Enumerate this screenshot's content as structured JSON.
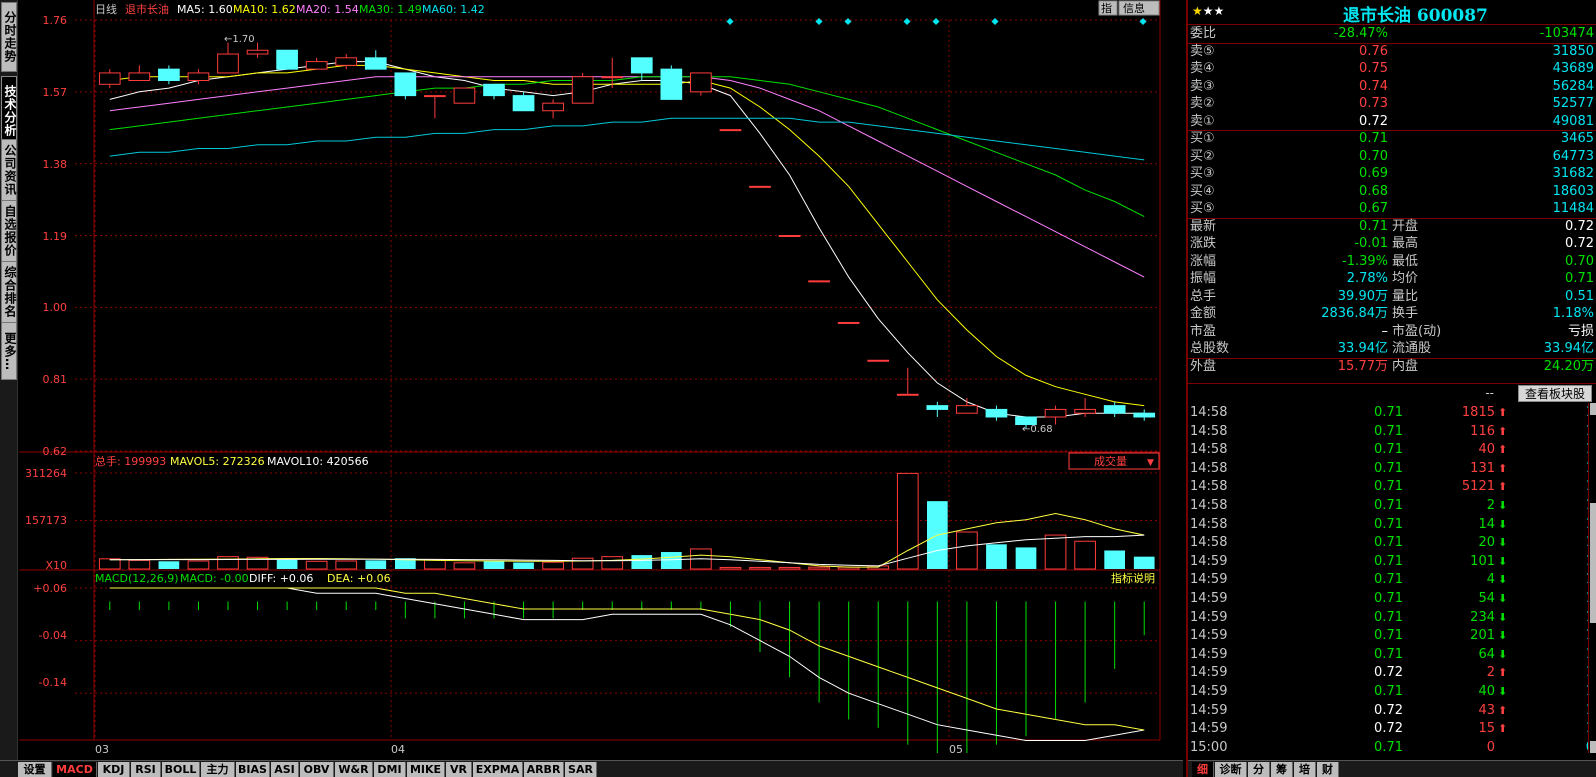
{
  "left_tabs": [
    {
      "label": "分时走势",
      "active": false
    },
    {
      "label": "技术分析",
      "active": true
    },
    {
      "label": "公司资讯",
      "active": false
    },
    {
      "label": "自选报价",
      "active": false
    },
    {
      "label": "综合排名",
      "active": false
    },
    {
      "label": "更多…",
      "active": false
    }
  ],
  "header": {
    "period": "日线",
    "stock_name": "退市长油",
    "ma5": "MA5: 1.60",
    "ma10": "MA10: 1.62",
    "ma20": "MA20: 1.54",
    "ma30": "MA30: 1.49",
    "ma60": "MA60: 1.42",
    "btn_zhi": "指",
    "btn_info": "信息"
  },
  "price_axis_labels": [
    "1.76",
    "1.57",
    "1.38",
    "1.19",
    "1.00",
    "0.81",
    "0.62"
  ],
  "price_annotations": {
    "high": "1.70",
    "low": "0.68"
  },
  "volume_header": {
    "total": "总手: 199993",
    "mavol5": "MAVOL5: 272326",
    "mavol10": "MAVOL10: 420566",
    "dropdown": "成交量"
  },
  "volume_axis_labels": [
    "311264",
    "157173",
    "X10"
  ],
  "macd_header": {
    "name": "MACD(12,26,9)",
    "macd": "MACD: -0.00",
    "diff": "DIFF: +0.06",
    "dea": "DEA: +0.06",
    "help": "指标说明"
  },
  "macd_axis_labels": [
    "+0.06",
    "-0.04",
    "-0.14"
  ],
  "date_labels": [
    "03",
    "04",
    "05"
  ],
  "bottom_tabs": [
    {
      "label": "设置",
      "active": false
    },
    {
      "label": "MACD",
      "active": true
    },
    {
      "label": "KDJ",
      "active": false
    },
    {
      "label": "RSI",
      "active": false
    },
    {
      "label": "BOLL",
      "active": false
    },
    {
      "label": "主力",
      "active": false
    },
    {
      "label": "BIAS",
      "active": false
    },
    {
      "label": "ASI",
      "active": false
    },
    {
      "label": "OBV",
      "active": false
    },
    {
      "label": "W&R",
      "active": false
    },
    {
      "label": "DMI",
      "active": false
    },
    {
      "label": "MIKE",
      "active": false
    },
    {
      "label": "VR",
      "active": false
    },
    {
      "label": "EXPMA",
      "active": false
    },
    {
      "label": "ARBR",
      "active": false
    },
    {
      "label": "SAR",
      "active": false
    }
  ],
  "colors": {
    "up": "#ff3c3c",
    "down": "#54ffff",
    "ma5": "#ffffff",
    "ma10": "#ffff00",
    "ma20": "#ff80ff",
    "ma30": "#00e000",
    "ma60": "#00c8d8",
    "grid": "#8c0000"
  },
  "chart_data": [
    {
      "type": "candlestick",
      "title": "日线",
      "x": [
        "03",
        "04",
        "05"
      ],
      "ylim": [
        0.62,
        1.76
      ],
      "candles": [
        {
          "o": 1.59,
          "c": 1.62,
          "h": 1.63,
          "l": 1.58
        },
        {
          "o": 1.6,
          "c": 1.62,
          "h": 1.64,
          "l": 1.6
        },
        {
          "o": 1.63,
          "c": 1.6,
          "h": 1.64,
          "l": 1.59
        },
        {
          "o": 1.6,
          "c": 1.62,
          "h": 1.63,
          "l": 1.59
        },
        {
          "o": 1.62,
          "c": 1.67,
          "h": 1.7,
          "l": 1.62
        },
        {
          "o": 1.67,
          "c": 1.68,
          "h": 1.7,
          "l": 1.66
        },
        {
          "o": 1.68,
          "c": 1.63,
          "h": 1.68,
          "l": 1.63
        },
        {
          "o": 1.63,
          "c": 1.65,
          "h": 1.66,
          "l": 1.63
        },
        {
          "o": 1.64,
          "c": 1.66,
          "h": 1.67,
          "l": 1.63
        },
        {
          "o": 1.66,
          "c": 1.63,
          "h": 1.68,
          "l": 1.63
        },
        {
          "o": 1.62,
          "c": 1.56,
          "h": 1.62,
          "l": 1.55
        },
        {
          "o": 1.56,
          "c": 1.56,
          "h": 1.56,
          "l": 1.5
        },
        {
          "o": 1.54,
          "c": 1.58,
          "h": 1.58,
          "l": 1.54
        },
        {
          "o": 1.59,
          "c": 1.56,
          "h": 1.59,
          "l": 1.55
        },
        {
          "o": 1.56,
          "c": 1.52,
          "h": 1.57,
          "l": 1.52
        },
        {
          "o": 1.52,
          "c": 1.54,
          "h": 1.55,
          "l": 1.5
        },
        {
          "o": 1.54,
          "c": 1.61,
          "h": 1.62,
          "l": 1.54
        },
        {
          "o": 1.61,
          "c": 1.61,
          "h": 1.66,
          "l": 1.58
        },
        {
          "o": 1.66,
          "c": 1.62,
          "h": 1.66,
          "l": 1.6
        },
        {
          "o": 1.63,
          "c": 1.55,
          "h": 1.64,
          "l": 1.55
        },
        {
          "o": 1.57,
          "c": 1.62,
          "h": 1.62,
          "l": 1.56
        },
        {
          "o": 1.47,
          "c": 1.47,
          "h": 1.47,
          "l": 1.47
        },
        {
          "o": 1.32,
          "c": 1.32,
          "h": 1.32,
          "l": 1.32
        },
        {
          "o": 1.19,
          "c": 1.19,
          "h": 1.19,
          "l": 1.19
        },
        {
          "o": 1.07,
          "c": 1.07,
          "h": 1.07,
          "l": 1.07
        },
        {
          "o": 0.96,
          "c": 0.96,
          "h": 0.96,
          "l": 0.96
        },
        {
          "o": 0.86,
          "c": 0.86,
          "h": 0.86,
          "l": 0.86
        },
        {
          "o": 0.77,
          "c": 0.77,
          "h": 0.84,
          "l": 0.77
        },
        {
          "o": 0.74,
          "c": 0.73,
          "h": 0.75,
          "l": 0.71
        },
        {
          "o": 0.72,
          "c": 0.74,
          "h": 0.76,
          "l": 0.72
        },
        {
          "o": 0.73,
          "c": 0.71,
          "h": 0.74,
          "l": 0.7
        },
        {
          "o": 0.71,
          "c": 0.69,
          "h": 0.71,
          "l": 0.68
        },
        {
          "o": 0.71,
          "c": 0.73,
          "h": 0.74,
          "l": 0.69
        },
        {
          "o": 0.72,
          "c": 0.73,
          "h": 0.76,
          "l": 0.71
        },
        {
          "o": 0.74,
          "c": 0.72,
          "h": 0.75,
          "l": 0.71
        },
        {
          "o": 0.72,
          "c": 0.71,
          "h": 0.73,
          "l": 0.7
        }
      ],
      "ma_series": [
        {
          "name": "MA5",
          "values": [
            1.55,
            1.57,
            1.58,
            1.6,
            1.61,
            1.62,
            1.63,
            1.64,
            1.65,
            1.65,
            1.63,
            1.61,
            1.6,
            1.58,
            1.57,
            1.56,
            1.57,
            1.59,
            1.6,
            1.6,
            1.59,
            1.56,
            1.46,
            1.35,
            1.21,
            1.08,
            0.97,
            0.88,
            0.8,
            0.75,
            0.72,
            0.71,
            0.71,
            0.72,
            0.72,
            0.72
          ]
        },
        {
          "name": "MA10",
          "values": [
            1.6,
            1.61,
            1.61,
            1.61,
            1.61,
            1.62,
            1.62,
            1.63,
            1.64,
            1.64,
            1.63,
            1.62,
            1.61,
            1.6,
            1.6,
            1.59,
            1.59,
            1.59,
            1.59,
            1.59,
            1.6,
            1.58,
            1.53,
            1.47,
            1.4,
            1.32,
            1.22,
            1.12,
            1.02,
            0.94,
            0.87,
            0.82,
            0.79,
            0.77,
            0.75,
            0.74
          ]
        },
        {
          "name": "MA20",
          "values": [
            1.52,
            1.53,
            1.54,
            1.55,
            1.56,
            1.57,
            1.58,
            1.59,
            1.6,
            1.61,
            1.61,
            1.61,
            1.61,
            1.61,
            1.61,
            1.61,
            1.61,
            1.61,
            1.61,
            1.61,
            1.61,
            1.6,
            1.58,
            1.55,
            1.52,
            1.48,
            1.44,
            1.4,
            1.36,
            1.32,
            1.28,
            1.24,
            1.2,
            1.16,
            1.12,
            1.08
          ]
        },
        {
          "name": "MA30",
          "values": [
            1.47,
            1.48,
            1.49,
            1.5,
            1.51,
            1.52,
            1.53,
            1.54,
            1.55,
            1.56,
            1.57,
            1.58,
            1.58,
            1.59,
            1.59,
            1.6,
            1.6,
            1.6,
            1.61,
            1.61,
            1.61,
            1.61,
            1.6,
            1.59,
            1.57,
            1.55,
            1.53,
            1.5,
            1.47,
            1.44,
            1.41,
            1.38,
            1.35,
            1.31,
            1.28,
            1.24
          ]
        },
        {
          "name": "MA60",
          "values": [
            1.4,
            1.41,
            1.41,
            1.42,
            1.42,
            1.43,
            1.43,
            1.44,
            1.44,
            1.45,
            1.45,
            1.46,
            1.46,
            1.47,
            1.47,
            1.48,
            1.48,
            1.49,
            1.49,
            1.5,
            1.5,
            1.5,
            1.5,
            1.5,
            1.49,
            1.49,
            1.48,
            1.47,
            1.46,
            1.45,
            1.44,
            1.43,
            1.42,
            1.41,
            1.4,
            1.39
          ]
        }
      ]
    },
    {
      "type": "bar",
      "title": "成交量",
      "ylim": [
        0,
        311264
      ],
      "values": [
        33000,
        28000,
        25000,
        26000,
        40000,
        38000,
        30000,
        25000,
        26000,
        28000,
        35000,
        30000,
        20000,
        25000,
        21000,
        22000,
        35000,
        40000,
        45000,
        55000,
        65000,
        5000,
        5000,
        5000,
        6000,
        6000,
        10000,
        310000,
        220000,
        120000,
        80000,
        70000,
        110000,
        90000,
        60000,
        40000
      ],
      "mavol5": [
        30000,
        30500,
        31000,
        31500,
        32000,
        33000,
        34000,
        34000,
        33000,
        32000,
        30000,
        28000,
        27000,
        26000,
        25000,
        25000,
        26000,
        28000,
        32000,
        38000,
        45000,
        40000,
        30000,
        20000,
        10000,
        6000,
        6000,
        60000,
        110000,
        130000,
        150000,
        160000,
        180000,
        160000,
        130000,
        110000
      ],
      "mavol10": [
        30000,
        30200,
        30400,
        30600,
        30800,
        31000,
        31200,
        31400,
        31600,
        31800,
        31500,
        31000,
        30500,
        30000,
        29000,
        28000,
        27000,
        27000,
        28000,
        30000,
        33000,
        30000,
        25000,
        20000,
        15000,
        12000,
        10000,
        35000,
        60000,
        75000,
        85000,
        95000,
        100000,
        105000,
        105000,
        110000
      ]
    },
    {
      "type": "bar",
      "title": "MACD(12,26,9)",
      "ylim": [
        -0.21,
        0.06
      ],
      "macd": [
        -0.01,
        -0.01,
        -0.01,
        -0.01,
        -0.01,
        -0.01,
        -0.01,
        -0.01,
        -0.01,
        -0.01,
        -0.02,
        -0.02,
        -0.02,
        -0.02,
        -0.02,
        -0.02,
        -0.01,
        -0.01,
        -0.01,
        -0.01,
        -0.01,
        -0.03,
        -0.06,
        -0.09,
        -0.12,
        -0.14,
        -0.15,
        -0.17,
        -0.18,
        -0.18,
        -0.17,
        -0.16,
        -0.14,
        -0.12,
        -0.08,
        -0.04
      ],
      "diff": [
        0.06,
        0.06,
        0.06,
        0.06,
        0.06,
        0.06,
        0.06,
        0.05,
        0.05,
        0.05,
        0.04,
        0.03,
        0.02,
        0.01,
        0.0,
        0.0,
        0.0,
        0.01,
        0.01,
        0.01,
        0.01,
        -0.01,
        -0.04,
        -0.07,
        -0.11,
        -0.14,
        -0.16,
        -0.18,
        -0.2,
        -0.21,
        -0.22,
        -0.23,
        -0.23,
        -0.23,
        -0.22,
        -0.21
      ],
      "dea": [
        0.06,
        0.06,
        0.06,
        0.06,
        0.06,
        0.06,
        0.06,
        0.06,
        0.06,
        0.06,
        0.05,
        0.05,
        0.04,
        0.03,
        0.02,
        0.02,
        0.02,
        0.02,
        0.02,
        0.02,
        0.02,
        0.01,
        0.0,
        -0.02,
        -0.05,
        -0.07,
        -0.09,
        -0.11,
        -0.13,
        -0.15,
        -0.17,
        -0.18,
        -0.19,
        -0.2,
        -0.2,
        -0.21
      ]
    }
  ],
  "right_panel": {
    "stars_on": "★",
    "stars_off": "★★",
    "title": "退市长油 600087",
    "weibi": {
      "label": "委比",
      "pct": "-28.47%",
      "val": "-103474"
    },
    "asks": [
      {
        "label": "卖⑤",
        "price": "0.76",
        "vol": "31850"
      },
      {
        "label": "卖④",
        "price": "0.75",
        "vol": "43689"
      },
      {
        "label": "卖③",
        "price": "0.74",
        "vol": "56284"
      },
      {
        "label": "卖②",
        "price": "0.73",
        "vol": "52577"
      },
      {
        "label": "卖①",
        "price": "0.72",
        "vol": "49081"
      }
    ],
    "bids": [
      {
        "label": "买①",
        "price": "0.71",
        "vol": "3465"
      },
      {
        "label": "买②",
        "price": "0.70",
        "vol": "64773"
      },
      {
        "label": "买③",
        "price": "0.69",
        "vol": "31682"
      },
      {
        "label": "买④",
        "price": "0.68",
        "vol": "18603"
      },
      {
        "label": "买⑤",
        "price": "0.67",
        "vol": "11484"
      }
    ],
    "stats": [
      {
        "l1": "最新",
        "v1": "0.71",
        "l2": "开盘",
        "v2": "0.72"
      },
      {
        "l1": "涨跌",
        "v1": "-0.01",
        "l2": "最高",
        "v2": "0.72"
      },
      {
        "l1": "涨幅",
        "v1": "-1.39%",
        "l2": "最低",
        "v2": "0.70"
      },
      {
        "l1": "振幅",
        "v1": "2.78%",
        "l2": "均价",
        "v2": "0.71"
      },
      {
        "l1": "总手",
        "v1": "39.90万",
        "l2": "量比",
        "v2": "0.51"
      },
      {
        "l1": "金额",
        "v1": "2836.84万",
        "l2": "换手",
        "v2": "1.18%"
      },
      {
        "l1": "市盈",
        "v1": "–",
        "l2": "市盈(动)",
        "v2": "亏损"
      },
      {
        "l1": "总股数",
        "v1": "33.94亿",
        "l2": "流通股",
        "v2": "33.94亿"
      }
    ],
    "outer": {
      "l1": "外盘",
      "v1": "15.77万",
      "l2": "内盘",
      "v2": "24.20万"
    },
    "tick_dash": "--",
    "sector_button": "查看板块股",
    "ticks": [
      {
        "time": "14:58",
        "price": "0.71",
        "vol": "1815",
        "dir": "up",
        "count": "1"
      },
      {
        "time": "14:58",
        "price": "0.71",
        "vol": "116",
        "dir": "up",
        "count": "1"
      },
      {
        "time": "14:58",
        "price": "0.71",
        "vol": "40",
        "dir": "up",
        "count": "1"
      },
      {
        "time": "14:58",
        "price": "0.71",
        "vol": "131",
        "dir": "up",
        "count": "1"
      },
      {
        "time": "14:58",
        "price": "0.71",
        "vol": "5121",
        "dir": "up",
        "count": "1"
      },
      {
        "time": "14:58",
        "price": "0.71",
        "vol": "2",
        "dir": "down",
        "count": "1"
      },
      {
        "time": "14:58",
        "price": "0.71",
        "vol": "14",
        "dir": "down",
        "count": "1"
      },
      {
        "time": "14:58",
        "price": "0.71",
        "vol": "20",
        "dir": "down",
        "count": "1"
      },
      {
        "time": "14:59",
        "price": "0.71",
        "vol": "101",
        "dir": "down",
        "count": "1"
      },
      {
        "time": "14:59",
        "price": "0.71",
        "vol": "4",
        "dir": "down",
        "count": "1"
      },
      {
        "time": "14:59",
        "price": "0.71",
        "vol": "54",
        "dir": "down",
        "count": "1"
      },
      {
        "time": "14:59",
        "price": "0.71",
        "vol": "234",
        "dir": "down",
        "count": "1"
      },
      {
        "time": "14:59",
        "price": "0.71",
        "vol": "201",
        "dir": "down",
        "count": "1"
      },
      {
        "time": "14:59",
        "price": "0.71",
        "vol": "64",
        "dir": "down",
        "count": "1"
      },
      {
        "time": "14:59",
        "price": "0.72",
        "vol": "2",
        "dir": "up",
        "count": "1"
      },
      {
        "time": "14:59",
        "price": "0.71",
        "vol": "40",
        "dir": "down",
        "count": "1"
      },
      {
        "time": "14:59",
        "price": "0.72",
        "vol": "43",
        "dir": "up",
        "count": "1"
      },
      {
        "time": "14:59",
        "price": "0.72",
        "vol": "15",
        "dir": "up",
        "count": "1"
      },
      {
        "time": "15:00",
        "price": "0.71",
        "vol": "0",
        "dir": "none",
        "count": "0"
      }
    ],
    "bottom_tabs": [
      {
        "label": "细",
        "active": true
      },
      {
        "label": "诊断",
        "active": false
      },
      {
        "label": "分",
        "active": false
      },
      {
        "label": "筹",
        "active": false
      },
      {
        "label": "培",
        "active": false
      },
      {
        "label": "财",
        "active": false
      }
    ]
  }
}
